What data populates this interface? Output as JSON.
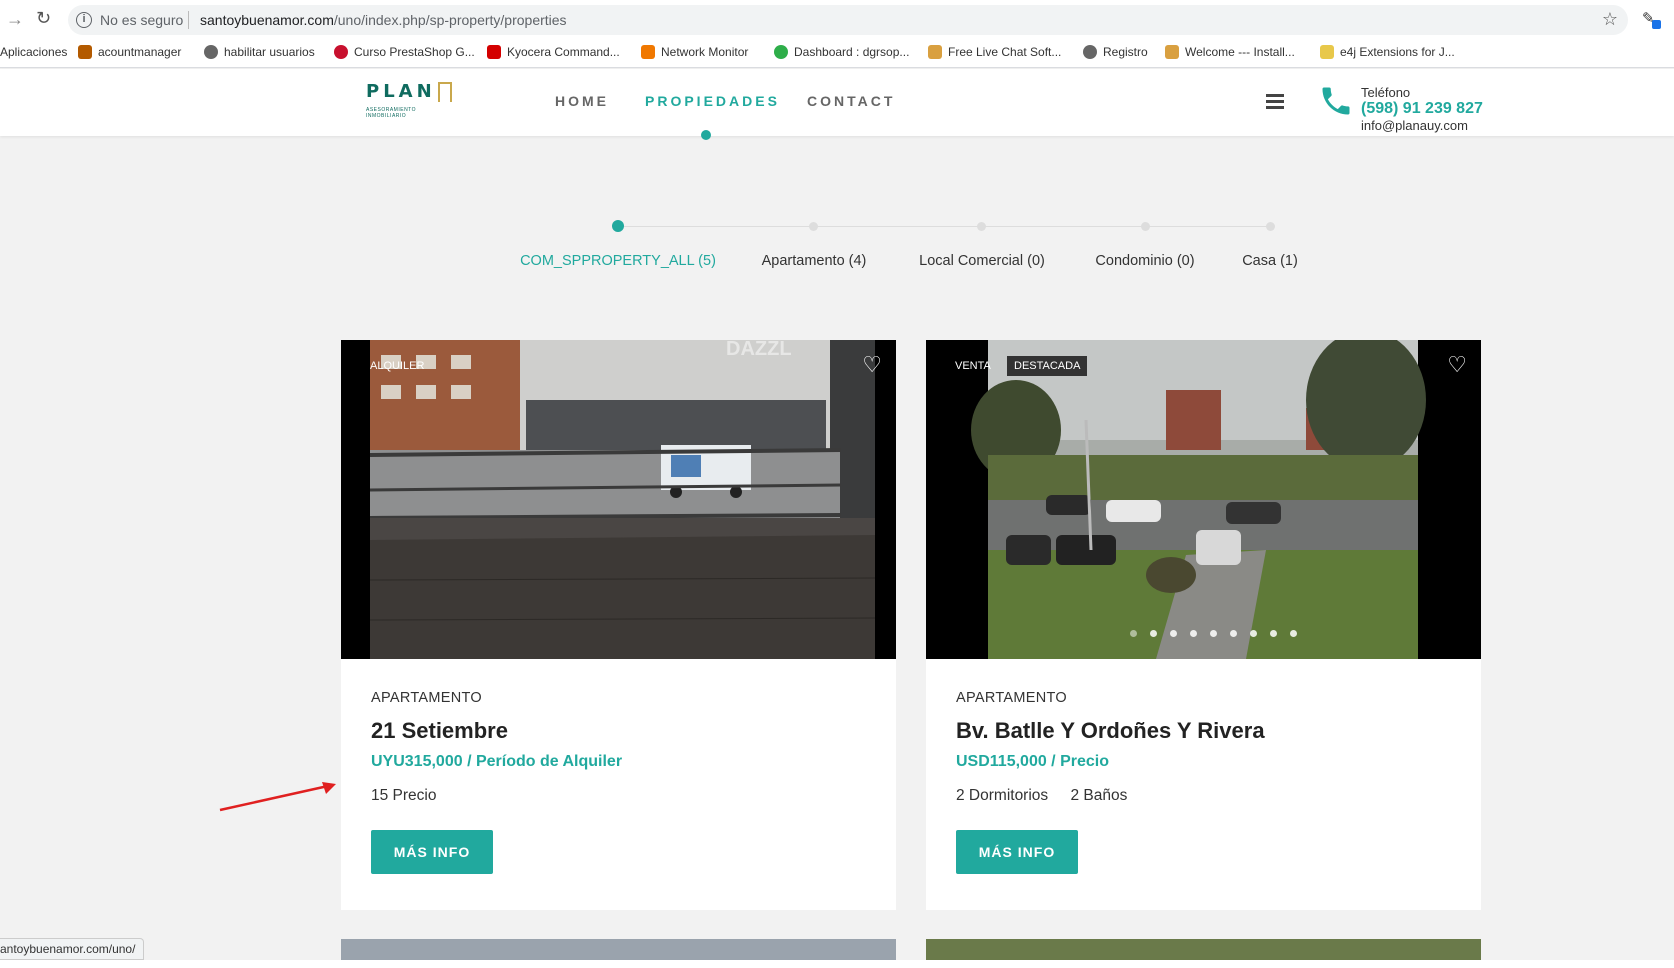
{
  "browser": {
    "security_label": "No es seguro",
    "url_host": "santoybuenamor.com",
    "url_path": "/uno/index.php/sp-property/properties",
    "status_url": "antoybuenamor.com/uno/",
    "bookmarks": [
      {
        "label": "Aplicaciones",
        "icon": "apps-icon"
      },
      {
        "label": "acountmanager",
        "icon": "dgr-icon"
      },
      {
        "label": "habilitar usuarios",
        "icon": "globe-icon"
      },
      {
        "label": "Curso PrestaShop G...",
        "icon": "prestashop-icon"
      },
      {
        "label": "Kyocera Command...",
        "icon": "kyocera-icon"
      },
      {
        "label": "Network Monitor",
        "icon": "network-monitor-icon"
      },
      {
        "label": "Dashboard : dgrsop...",
        "icon": "dashboard-icon"
      },
      {
        "label": "Free Live Chat Soft...",
        "icon": "chat-icon"
      },
      {
        "label": "Registro",
        "icon": "globe-icon"
      },
      {
        "label": "Welcome --- Install...",
        "icon": "chat-icon"
      },
      {
        "label": "e4j Extensions for J...",
        "icon": "e4j-icon"
      }
    ]
  },
  "header": {
    "logo_text": "PLAN",
    "logo_sub": "ASESORAMIENTO INMOBILIARIO",
    "nav": [
      {
        "label": "HOME"
      },
      {
        "label": "PROPIEDADES"
      },
      {
        "label": "CONTACT"
      }
    ],
    "phone_label": "Teléfono",
    "phone_number": "(598) 91 239 827",
    "email": "info@planauy.com"
  },
  "filters": [
    {
      "label": "COM_SPPROPERTY_ALL (5)",
      "active": true
    },
    {
      "label": "Apartamento (4)",
      "active": false
    },
    {
      "label": "Local Comercial (0)",
      "active": false
    },
    {
      "label": "Condominio (0)",
      "active": false
    },
    {
      "label": "Casa (1)",
      "active": false
    }
  ],
  "properties": [
    {
      "badges": [
        "ALQUILER"
      ],
      "type": "APARTAMENTO",
      "title": "21 Setiembre",
      "price": "UYU315,000 / Período de Alquiler",
      "meta": [
        "15 Precio"
      ],
      "button": "MÁS INFO"
    },
    {
      "badges": [
        "VENTA",
        "DESTACADA"
      ],
      "type": "APARTAMENTO",
      "title": "Bv. Batlle Y Ordoñes Y Rivera",
      "price": "USD115,000 / Precio",
      "meta": [
        "2 Dormitorios",
        "2 Baños"
      ],
      "button": "MÁS INFO"
    }
  ],
  "colors": {
    "accent": "#21a99e",
    "logo": "#0f6b5f",
    "annotation_arrow": "#e02020"
  }
}
